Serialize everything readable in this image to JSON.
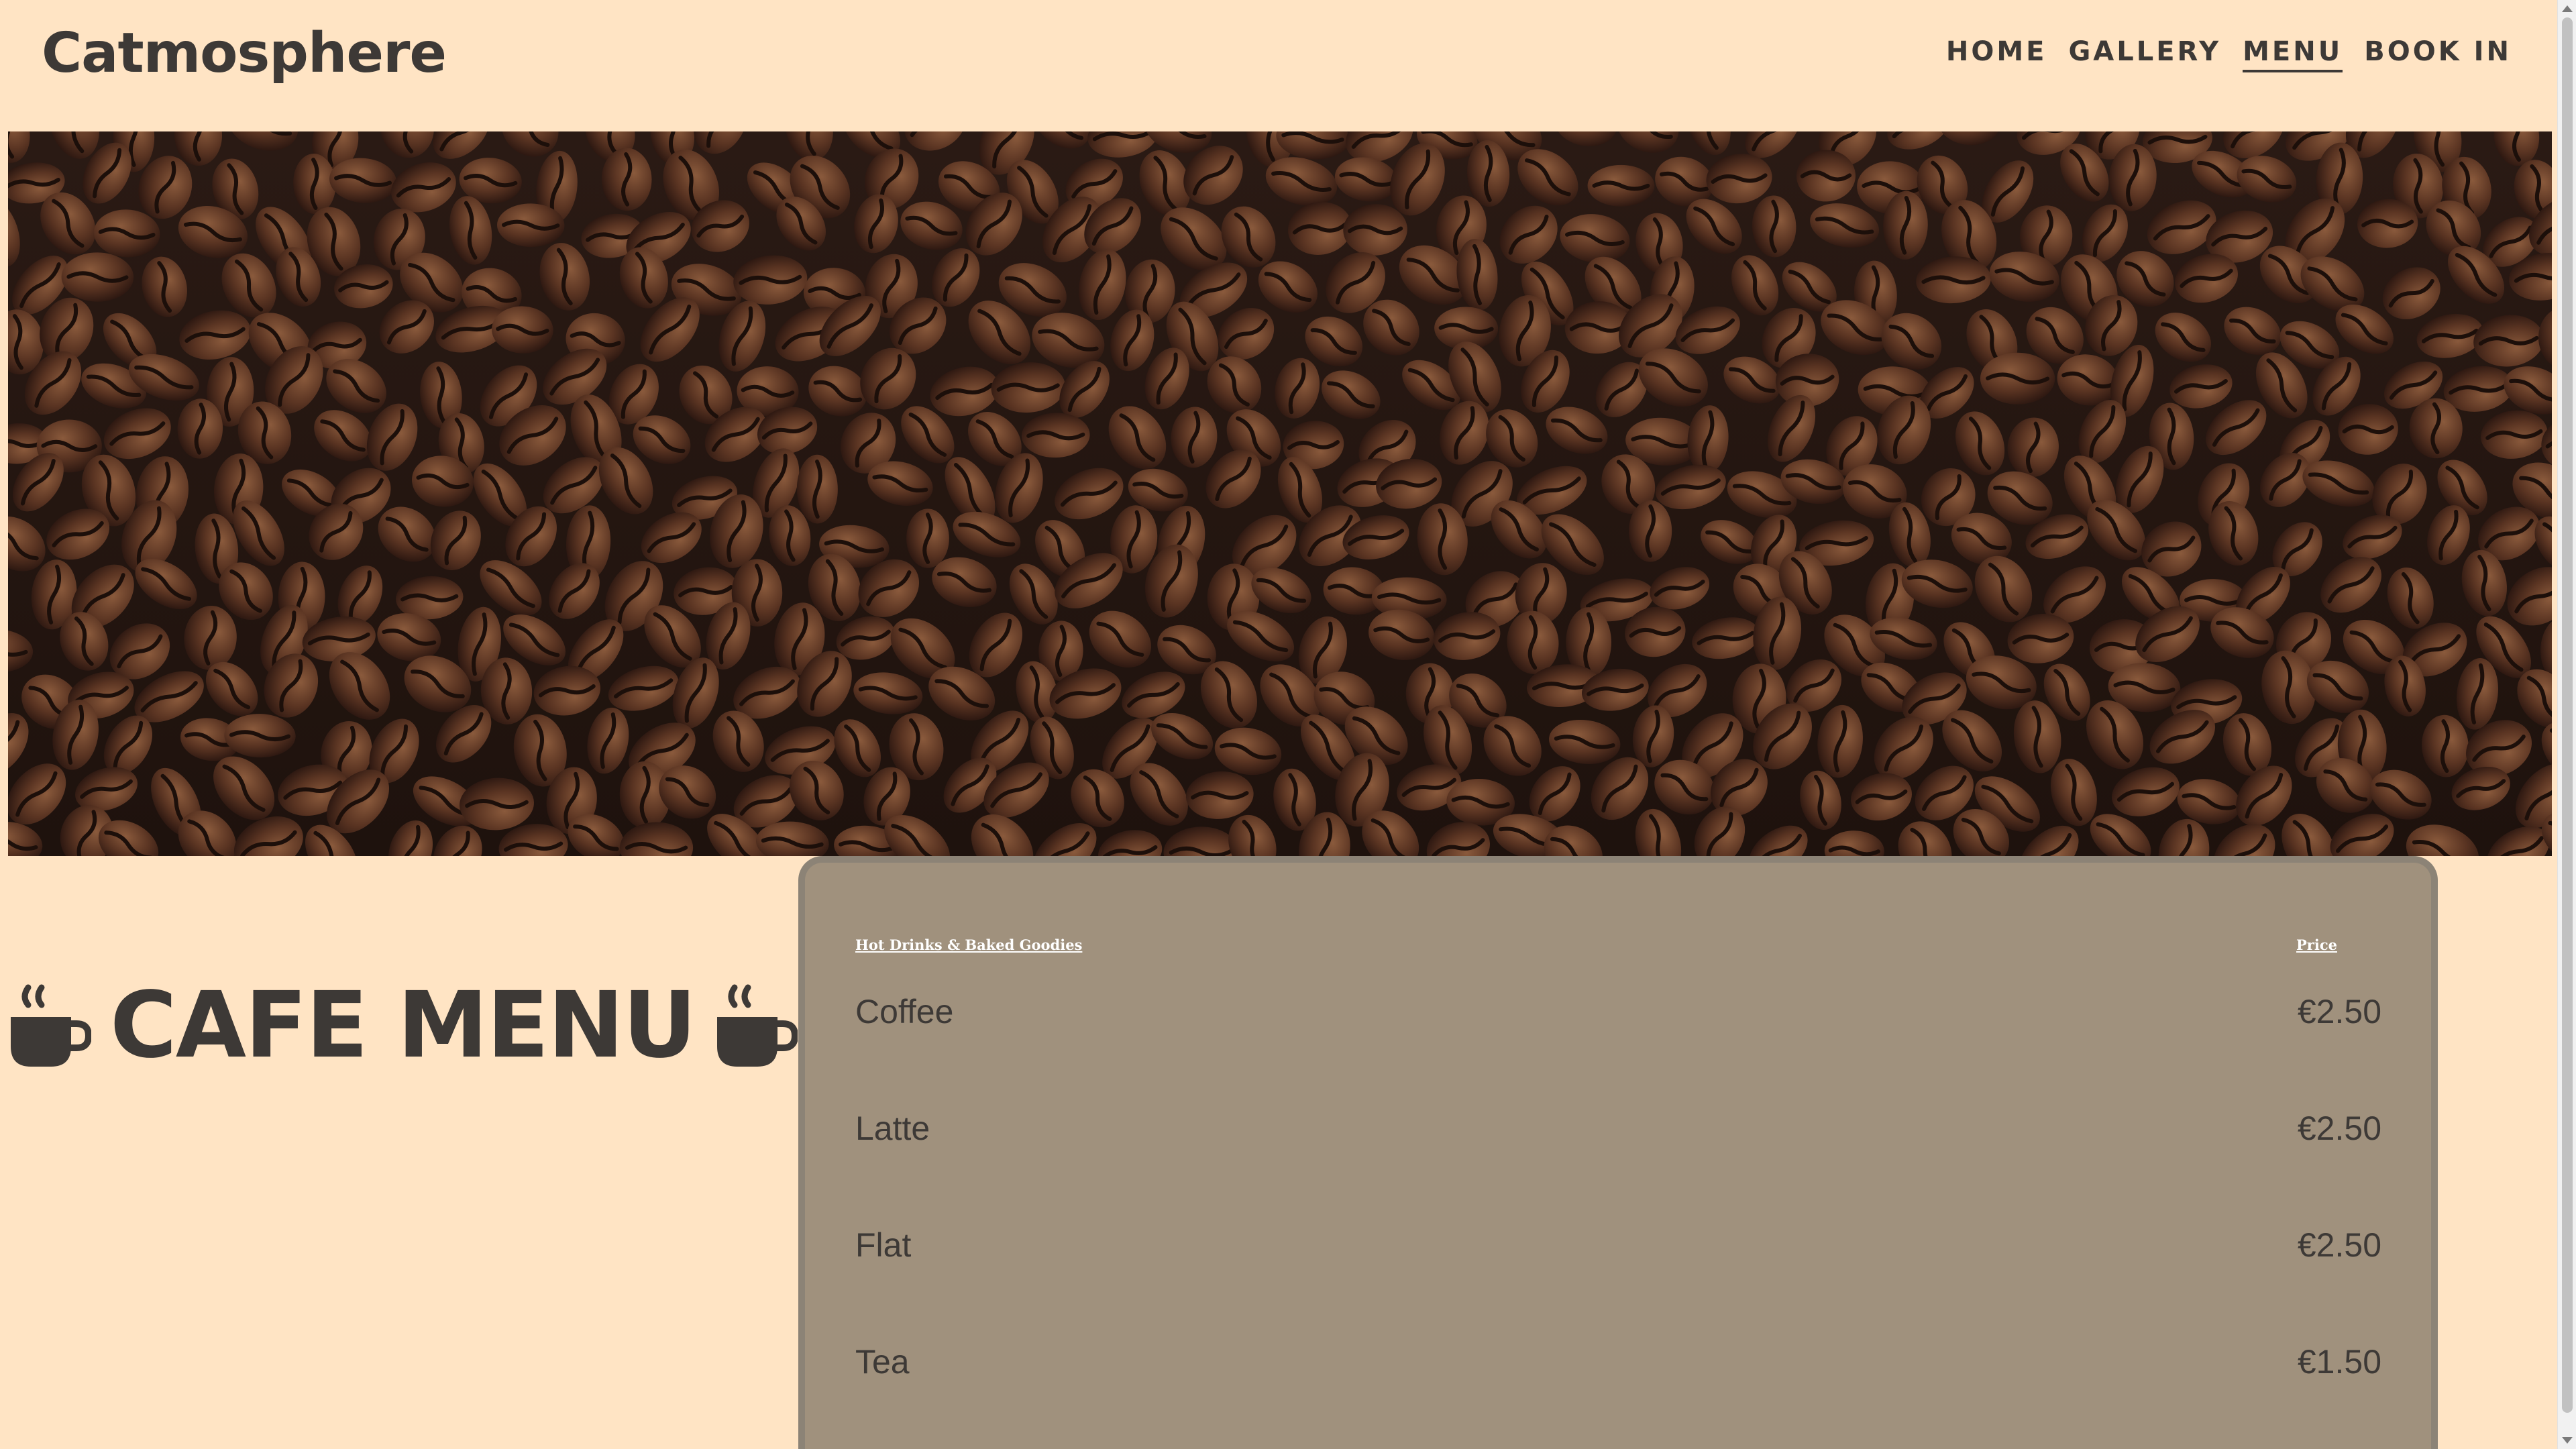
{
  "header": {
    "brand": "Catmosphere",
    "nav": [
      {
        "label": "HOME"
      },
      {
        "label": "GALLERY"
      },
      {
        "label": "MENU",
        "active": true
      },
      {
        "label": "BOOK IN"
      }
    ]
  },
  "hero": {
    "image": "coffee-beans-photo"
  },
  "cafe": {
    "title": "CAFE MENU",
    "icon": "coffee-cup-icon"
  },
  "menu": {
    "column_item": "Hot Drinks & Baked Goodies",
    "column_price": "Price",
    "items": [
      {
        "name": "Coffee",
        "price": "€2.50"
      },
      {
        "name": "Latte",
        "price": "€2.50"
      },
      {
        "name": "Flat",
        "price": "€2.50"
      },
      {
        "name": "Tea",
        "price": "€1.50"
      }
    ]
  },
  "colors": {
    "background": "#ffe4c4",
    "text": "#3d3936",
    "card": "#a0917d",
    "card_border": "#8c8376"
  }
}
